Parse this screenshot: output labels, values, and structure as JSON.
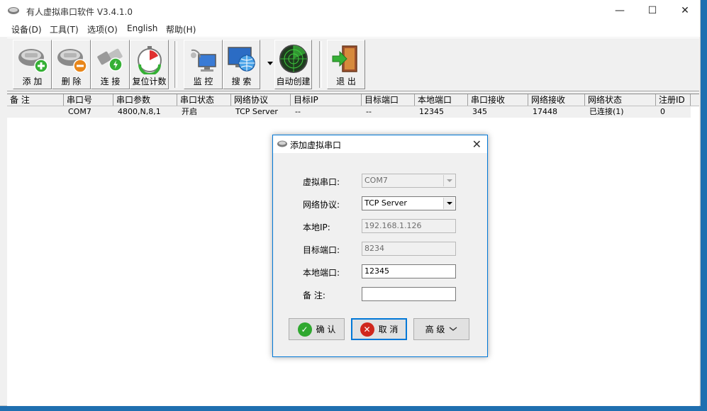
{
  "app": {
    "title": "有人虚拟串口软件 V3.4.1.0",
    "window_buttons": {
      "minimize": "—",
      "maximize": "☐",
      "close": "✕"
    }
  },
  "menu": [
    "设备(D)",
    "工具(T)",
    "选项(O)",
    "English",
    "帮助(H)"
  ],
  "toolbar": {
    "add": "添 加",
    "delete": "删 除",
    "connect": "连 接",
    "reset_count": "复位计数",
    "monitor": "监 控",
    "search": "搜 索",
    "auto_create": "自动创建",
    "exit": "退 出"
  },
  "table": {
    "columns": [
      "备 注",
      "串口号",
      "串口参数",
      "串口状态",
      "网络协议",
      "目标IP",
      "目标端口",
      "本地端口",
      "串口接收",
      "网络接收",
      "网络状态",
      "注册ID"
    ],
    "rows": [
      [
        "",
        "COM7",
        "4800,N,8,1",
        "开启",
        "TCP Server",
        "--",
        "--",
        "12345",
        "345",
        "17448",
        "已连接(1)",
        "0"
      ]
    ]
  },
  "dialog": {
    "title": "添加虚拟串口",
    "close": "✕",
    "fields": {
      "virtual_port_label": "虚拟串口:",
      "virtual_port_value": "COM7",
      "protocol_label": "网络协议:",
      "protocol_value": "TCP Server",
      "local_ip_label": "本地IP:",
      "local_ip_value": "192.168.1.126",
      "target_port_label": "目标端口:",
      "target_port_value": "8234",
      "local_port_label": "本地端口:",
      "local_port_value": "12345",
      "note_label": "备  注:",
      "note_value": ""
    },
    "buttons": {
      "ok": "确 认",
      "cancel": "取 消",
      "advanced": "高 级"
    }
  },
  "colors": {
    "accent": "#0078d7",
    "ok_green": "#2fa82f",
    "cancel_red": "#d0271d"
  }
}
